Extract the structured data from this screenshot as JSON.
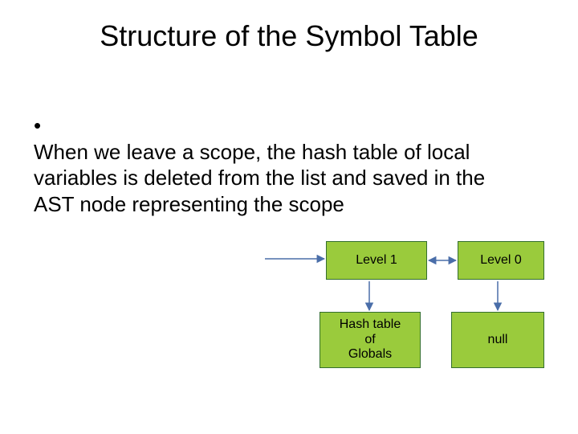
{
  "title": "Structure of the Symbol Table",
  "bullet": "When we leave a scope, the hash table of local variables is deleted from the list and saved in the AST node representing the scope",
  "boxes": {
    "level1": "Level 1",
    "level0": "Level 0",
    "globals": "Hash table\nof\nGlobals",
    "null": "null"
  }
}
